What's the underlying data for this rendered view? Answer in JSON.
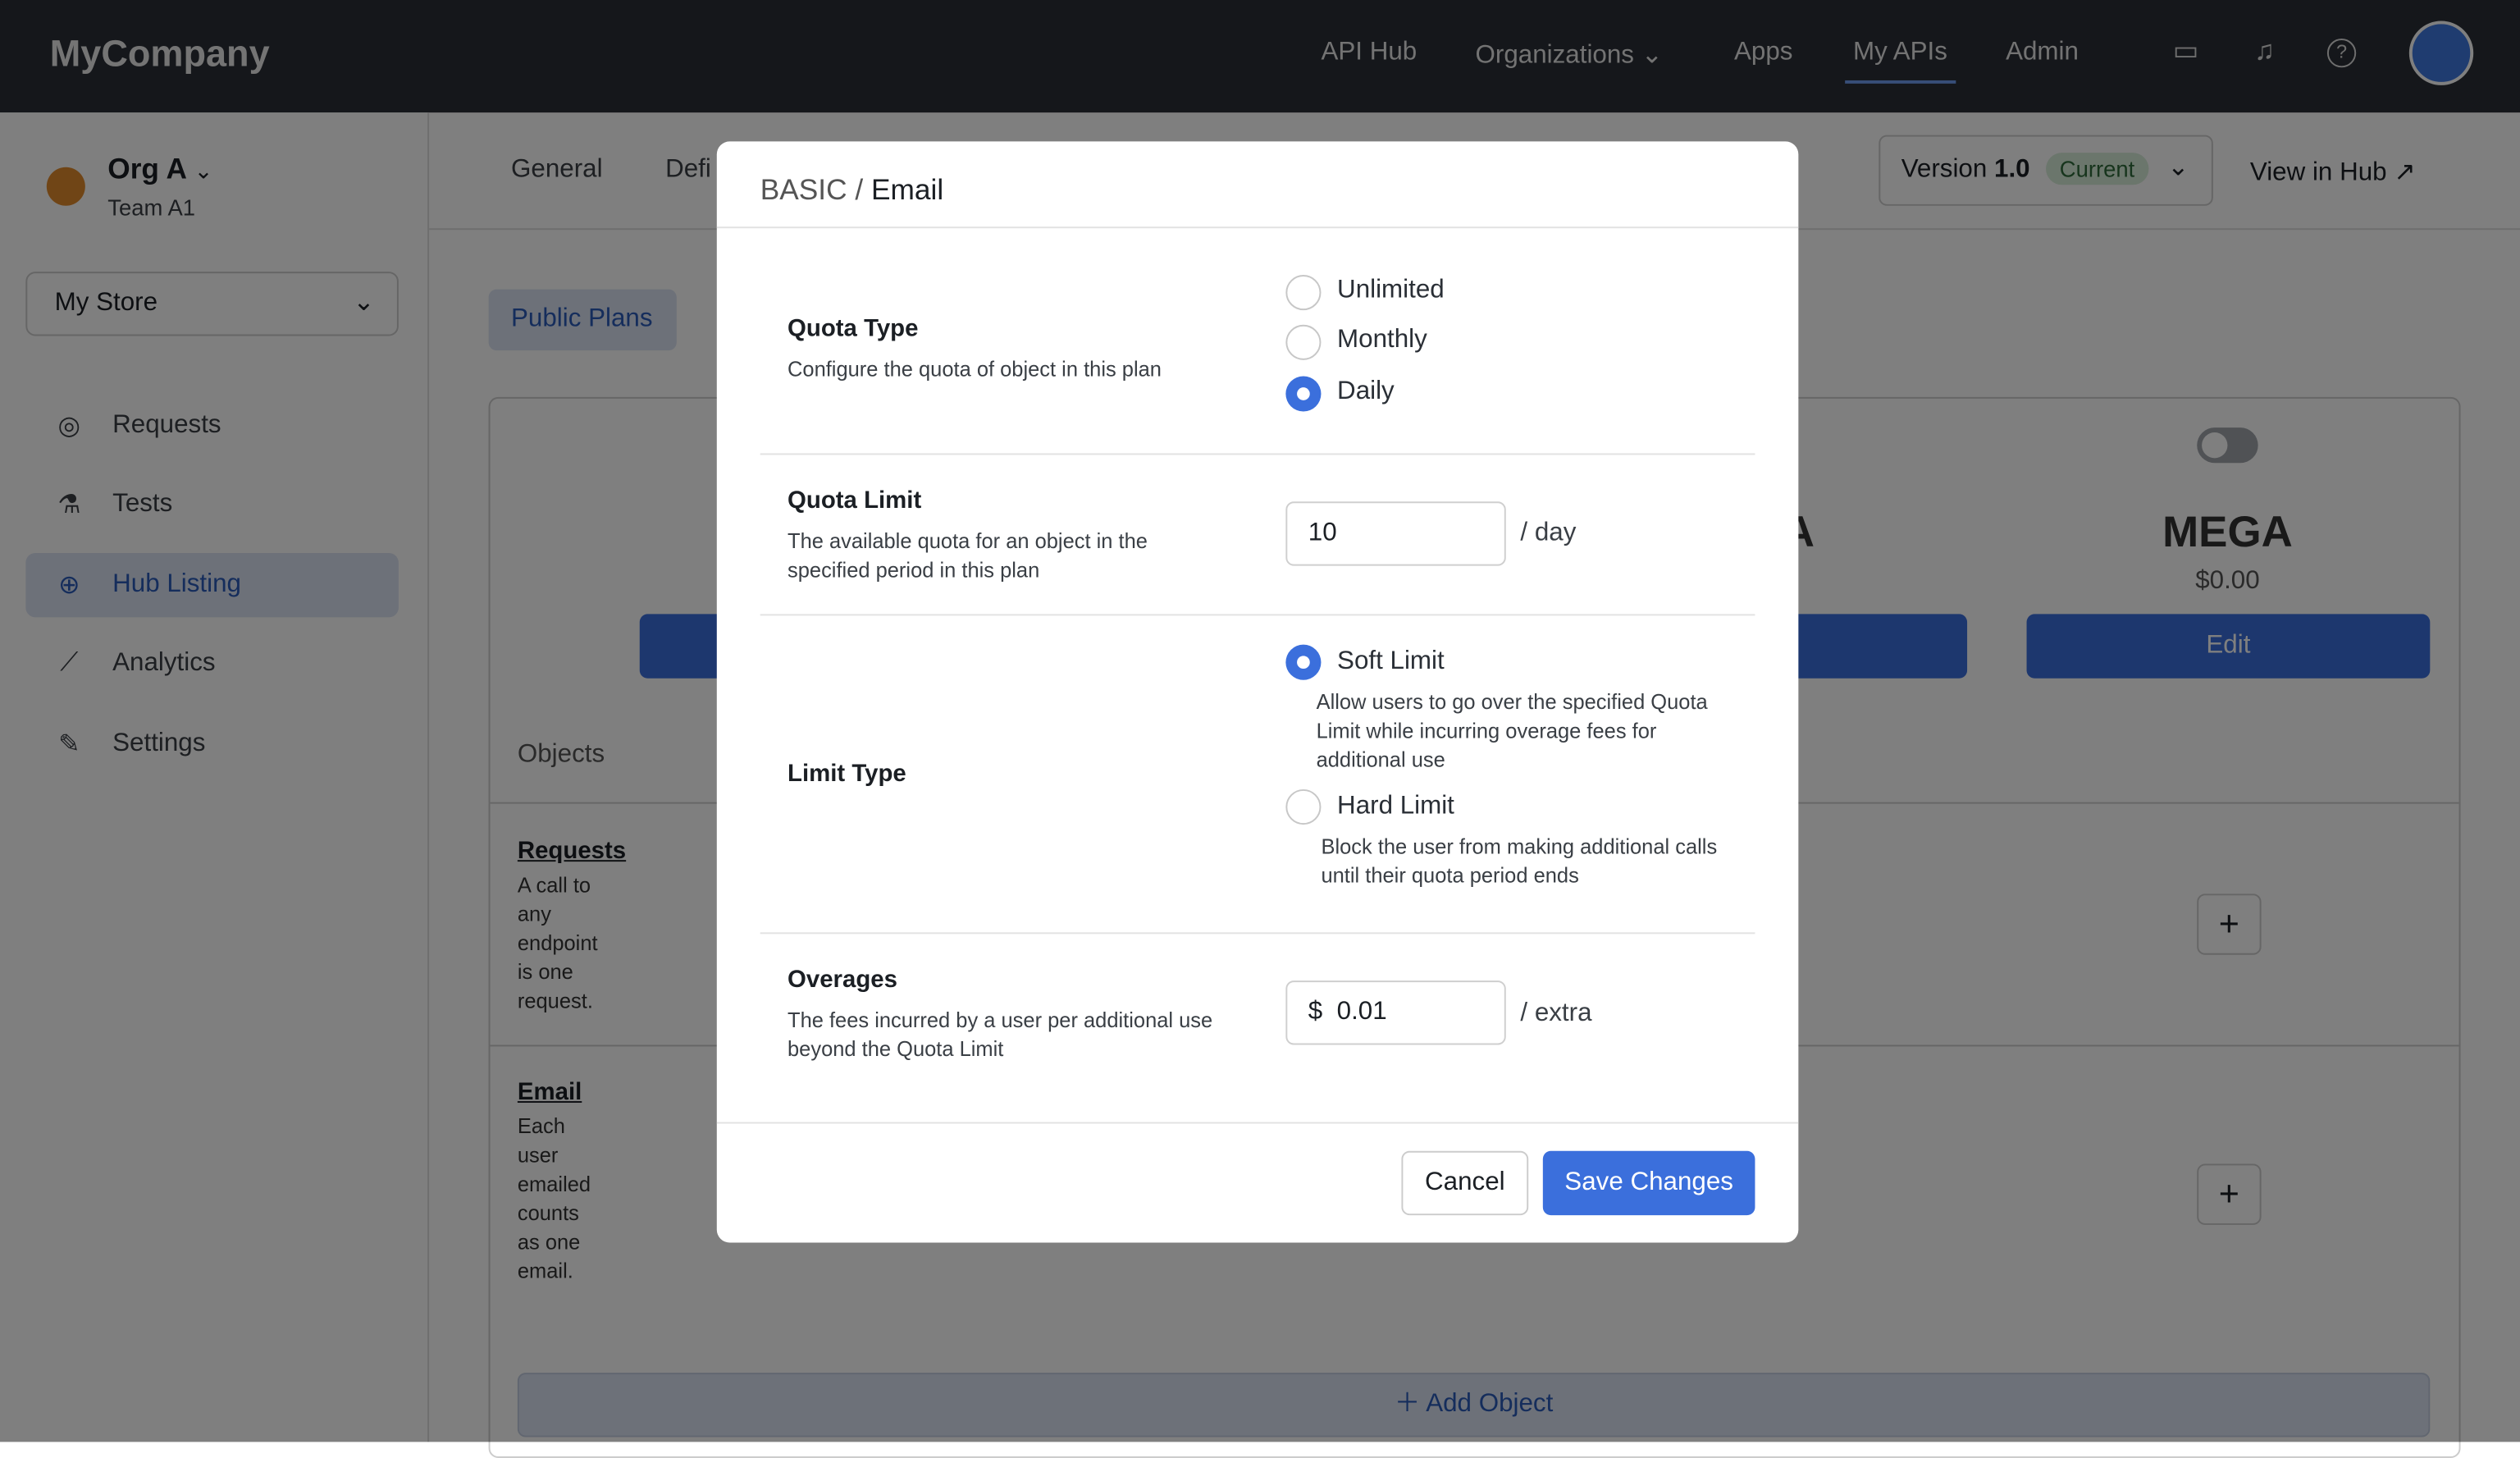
{
  "topbar": {
    "logo": "MyCompany",
    "nav": [
      "API Hub",
      "Organizations",
      "Apps",
      "My APIs",
      "Admin"
    ],
    "active": "My APIs",
    "icons": [
      "inbox-icon",
      "bell-icon",
      "help-icon"
    ]
  },
  "sidebar": {
    "org": "Org A",
    "team": "Team A1",
    "store": "My Store",
    "items": [
      {
        "label": "Requests",
        "icon": "requests-icon"
      },
      {
        "label": "Tests",
        "icon": "flask-icon"
      },
      {
        "label": "Hub Listing",
        "icon": "globe-icon"
      },
      {
        "label": "Analytics",
        "icon": "chart-icon"
      },
      {
        "label": "Settings",
        "icon": "pencil-icon"
      }
    ],
    "active": "Hub Listing"
  },
  "main": {
    "tabs": [
      "General",
      "Defi"
    ],
    "version_label": "Version",
    "version": "1.0",
    "version_badge": "Current",
    "view_in_hub": "View in Hub",
    "public_plans": "Public Plans",
    "plan_partial": "RA",
    "plan_name": "MEGA",
    "plan_price": "$0.00",
    "edit": "Edit",
    "objects_label": "Objects",
    "objects": [
      {
        "name": "Requests",
        "desc": "A call to any endpoint is one request."
      },
      {
        "name": "Email",
        "desc": "Each user emailed counts as one email."
      }
    ],
    "add_object": "Add Object"
  },
  "modal": {
    "breadcrumb_parent": "BASIC",
    "breadcrumb_sep": " / ",
    "breadcrumb_current": "Email",
    "quota_type": {
      "label": "Quota Type",
      "desc": "Configure the quota of object in this plan",
      "options": [
        "Unlimited",
        "Monthly",
        "Daily"
      ],
      "selected": "Daily"
    },
    "quota_limit": {
      "label": "Quota Limit",
      "desc": "The available quota for an object in the specified period in this plan",
      "value": "10",
      "unit": "/ day"
    },
    "limit_type": {
      "label": "Limit Type",
      "options": [
        {
          "label": "Soft Limit",
          "desc": "Allow users to go over the specified Quota Limit while incurring overage fees for additional use"
        },
        {
          "label": "Hard Limit",
          "desc": "Block the user from making additional calls until their quota period ends"
        }
      ],
      "selected": "Soft Limit"
    },
    "overages": {
      "label": "Overages",
      "desc": "The fees incurred by a user per additional use beyond the Quota Limit",
      "currency": "$",
      "value": "0.01",
      "unit": "/ extra"
    },
    "cancel": "Cancel",
    "save": "Save Changes"
  },
  "colors": {
    "primary": "#3b6fdc",
    "topbar": "#2a2f36"
  }
}
